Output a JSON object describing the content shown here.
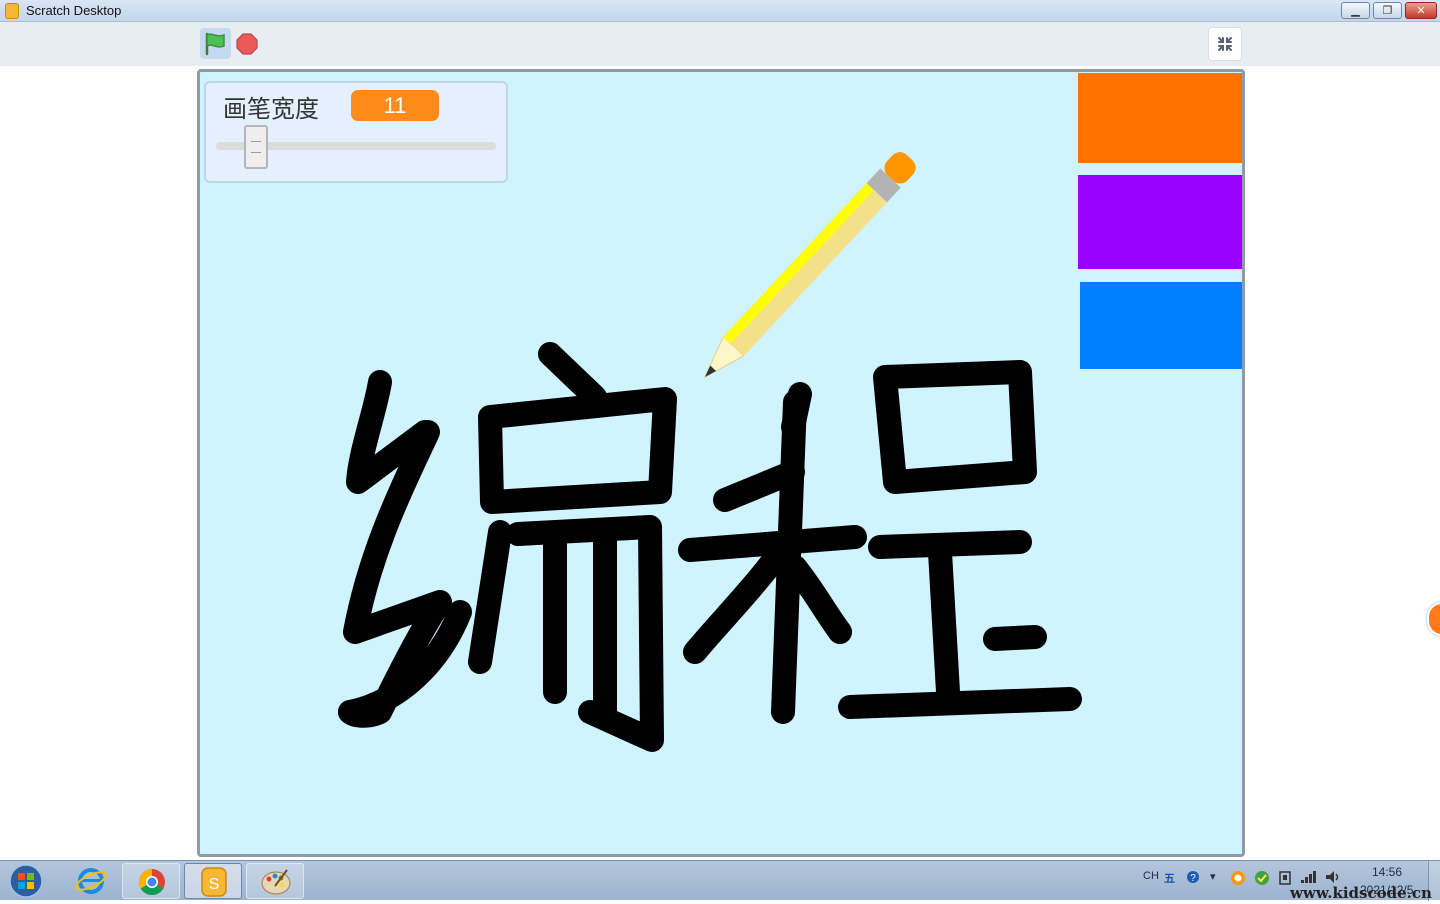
{
  "window": {
    "title": "Scratch Desktop"
  },
  "toolbar": {
    "green_flag": "green-flag",
    "stop": "stop-sign",
    "fullscreen_exit": "exit-fullscreen"
  },
  "stage": {
    "monitor": {
      "label": "画笔宽度",
      "value": "11",
      "slider_fraction": 0.11
    },
    "swatches": [
      {
        "name": "orange",
        "color": "#ff7200"
      },
      {
        "name": "purple",
        "color": "#9a00ff"
      },
      {
        "name": "blue",
        "color": "#0080ff"
      }
    ],
    "drawing_text": "编程",
    "background_color": "#cff3ff"
  },
  "taskbar": {
    "apps": [
      "start",
      "internet-explorer",
      "chrome",
      "scratch",
      "paint"
    ],
    "tray": {
      "lang": "CH",
      "ime": "五",
      "time": "14:56",
      "date": "2021/12/5"
    },
    "watermark": "www.kidscode.cn"
  }
}
